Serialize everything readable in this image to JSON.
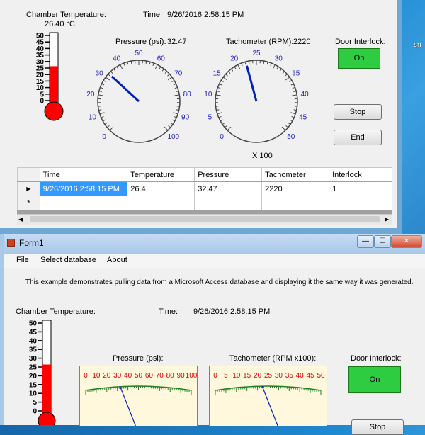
{
  "desktop": {
    "labels": [
      "b",
      "sn"
    ]
  },
  "window1": {
    "chamber_label": "Chamber Temperature:",
    "chamber_value": "26.40 °C",
    "time_label": "Time:",
    "time_value": "9/26/2016 2:58:15 PM",
    "thermometer": {
      "ticks": [
        "50",
        "45",
        "40",
        "35",
        "30",
        "25",
        "20",
        "15",
        "10",
        "5",
        "0"
      ],
      "level": 26.4,
      "max": 50
    },
    "pressure": {
      "label": "Pressure (psi):",
      "value": "32.47",
      "ticks": [
        "0",
        "10",
        "20",
        "30",
        "40",
        "50",
        "60",
        "70",
        "80",
        "90",
        "100"
      ],
      "reading": 32.47,
      "max": 100
    },
    "tachometer": {
      "label": "Tachometer (RPM):",
      "value": "2220",
      "ticks": [
        "0",
        "5",
        "10",
        "15",
        "20",
        "25",
        "30",
        "35",
        "40",
        "45",
        "50"
      ],
      "reading": 22.2,
      "max": 50,
      "multiplier": "X 100"
    },
    "door": {
      "label": "Door Interlock:",
      "state": "On",
      "color": "#2ecc40"
    },
    "stop_label": "Stop",
    "end_label": "End",
    "grid": {
      "columns": [
        "Time",
        "Temperature",
        "Pressure",
        "Tachometer",
        "Interlock"
      ],
      "rows": [
        {
          "marker": "▶",
          "cells": [
            "9/26/2016 2:58:15 PM",
            "26.4",
            "32.47",
            "2220",
            "1"
          ]
        }
      ],
      "new_row_marker": "*"
    }
  },
  "window2": {
    "title": "Form1",
    "menu": [
      "File",
      "Select database",
      "About"
    ],
    "description": "This example demonstrates pulling data from a Microsoft Access database and displaying it the same way it was generated.",
    "chamber_label": "Chamber Temperature:",
    "time_label": "Time:",
    "time_value": "9/26/2016 2:58:15 PM",
    "thermometer": {
      "ticks": [
        "50",
        "45",
        "40",
        "35",
        "30",
        "25",
        "20",
        "15",
        "10",
        "5",
        "0"
      ],
      "level": 26.4,
      "max": 50
    },
    "pressure_label": "Pressure (psi):",
    "pressure_ticks": [
      "0",
      "10",
      "20",
      "30",
      "40",
      "50",
      "60",
      "70",
      "80",
      "90",
      "100"
    ],
    "tach_label": "Tachometer (RPM x100):",
    "tach_ticks": [
      "0",
      "5",
      "10",
      "15",
      "20",
      "25",
      "30",
      "35",
      "40",
      "45",
      "50"
    ],
    "door_label": "Door Interlock:",
    "door_state": "On",
    "door_color": "#2ecc40",
    "stop_label": "Stop",
    "controls": {
      "minimize": "—",
      "maximize": "☐",
      "close": "✕"
    }
  }
}
